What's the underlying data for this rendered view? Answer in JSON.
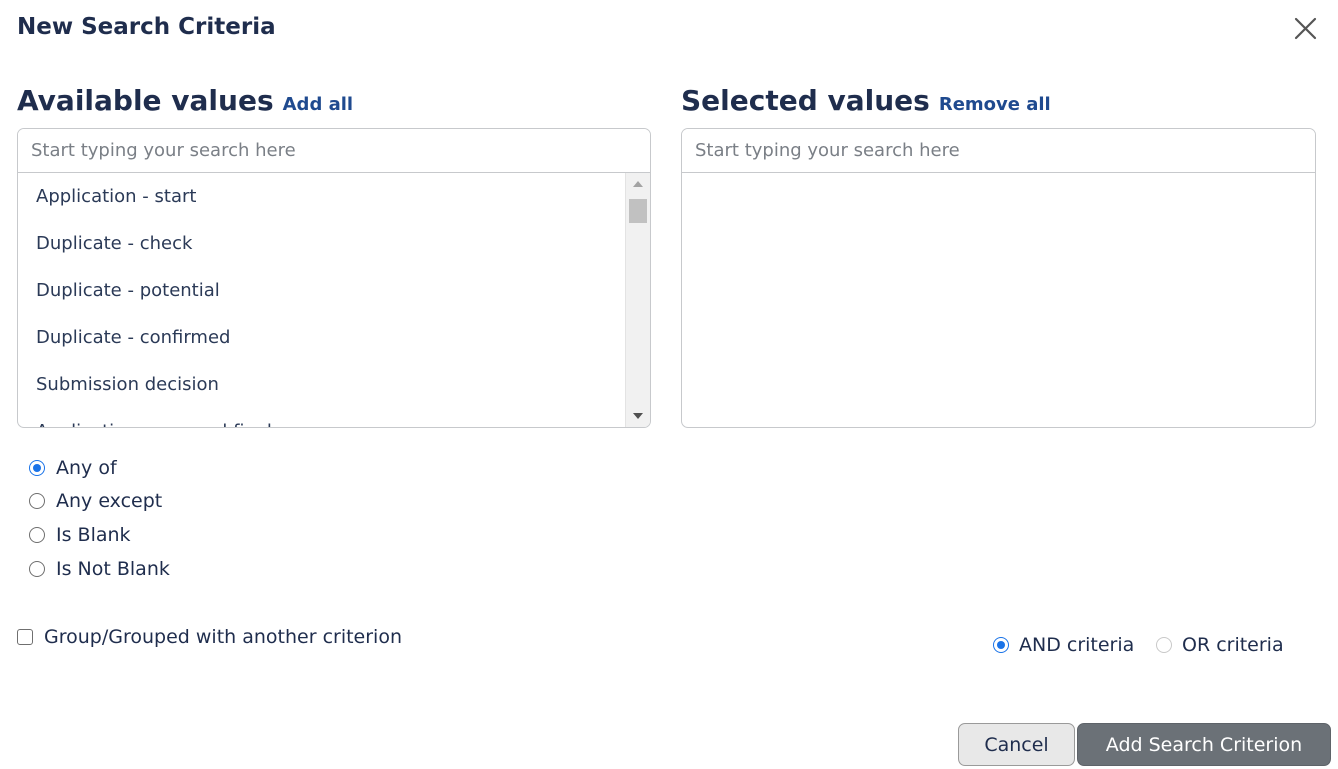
{
  "dialog": {
    "title": "New Search Criteria"
  },
  "available": {
    "heading": "Available values",
    "add_all_label": "Add all",
    "search_placeholder": "Start typing your search here",
    "items": [
      "Application - start",
      "Duplicate - check",
      "Duplicate - potential",
      "Duplicate - confirmed",
      "Submission decision",
      "Application approved final"
    ]
  },
  "selected": {
    "heading": "Selected values",
    "remove_all_label": "Remove all",
    "search_placeholder": "Start typing your search here",
    "items": []
  },
  "match_options": [
    {
      "label": "Any of",
      "checked": true
    },
    {
      "label": "Any except",
      "checked": false
    },
    {
      "label": "Is Blank",
      "checked": false
    },
    {
      "label": "Is Not Blank",
      "checked": false
    }
  ],
  "group": {
    "label": "Group/Grouped with another criterion",
    "checked": false
  },
  "logic": {
    "and_label": "AND criteria",
    "and_checked": true,
    "or_label": "OR criteria",
    "or_checked": false
  },
  "buttons": {
    "cancel_label": "Cancel",
    "add_label": "Add Search Criterion"
  },
  "colors": {
    "accent": "#1a73e8",
    "link": "#1f4a8f",
    "text": "#1f2d4d",
    "primary_button": "#6b7177"
  }
}
